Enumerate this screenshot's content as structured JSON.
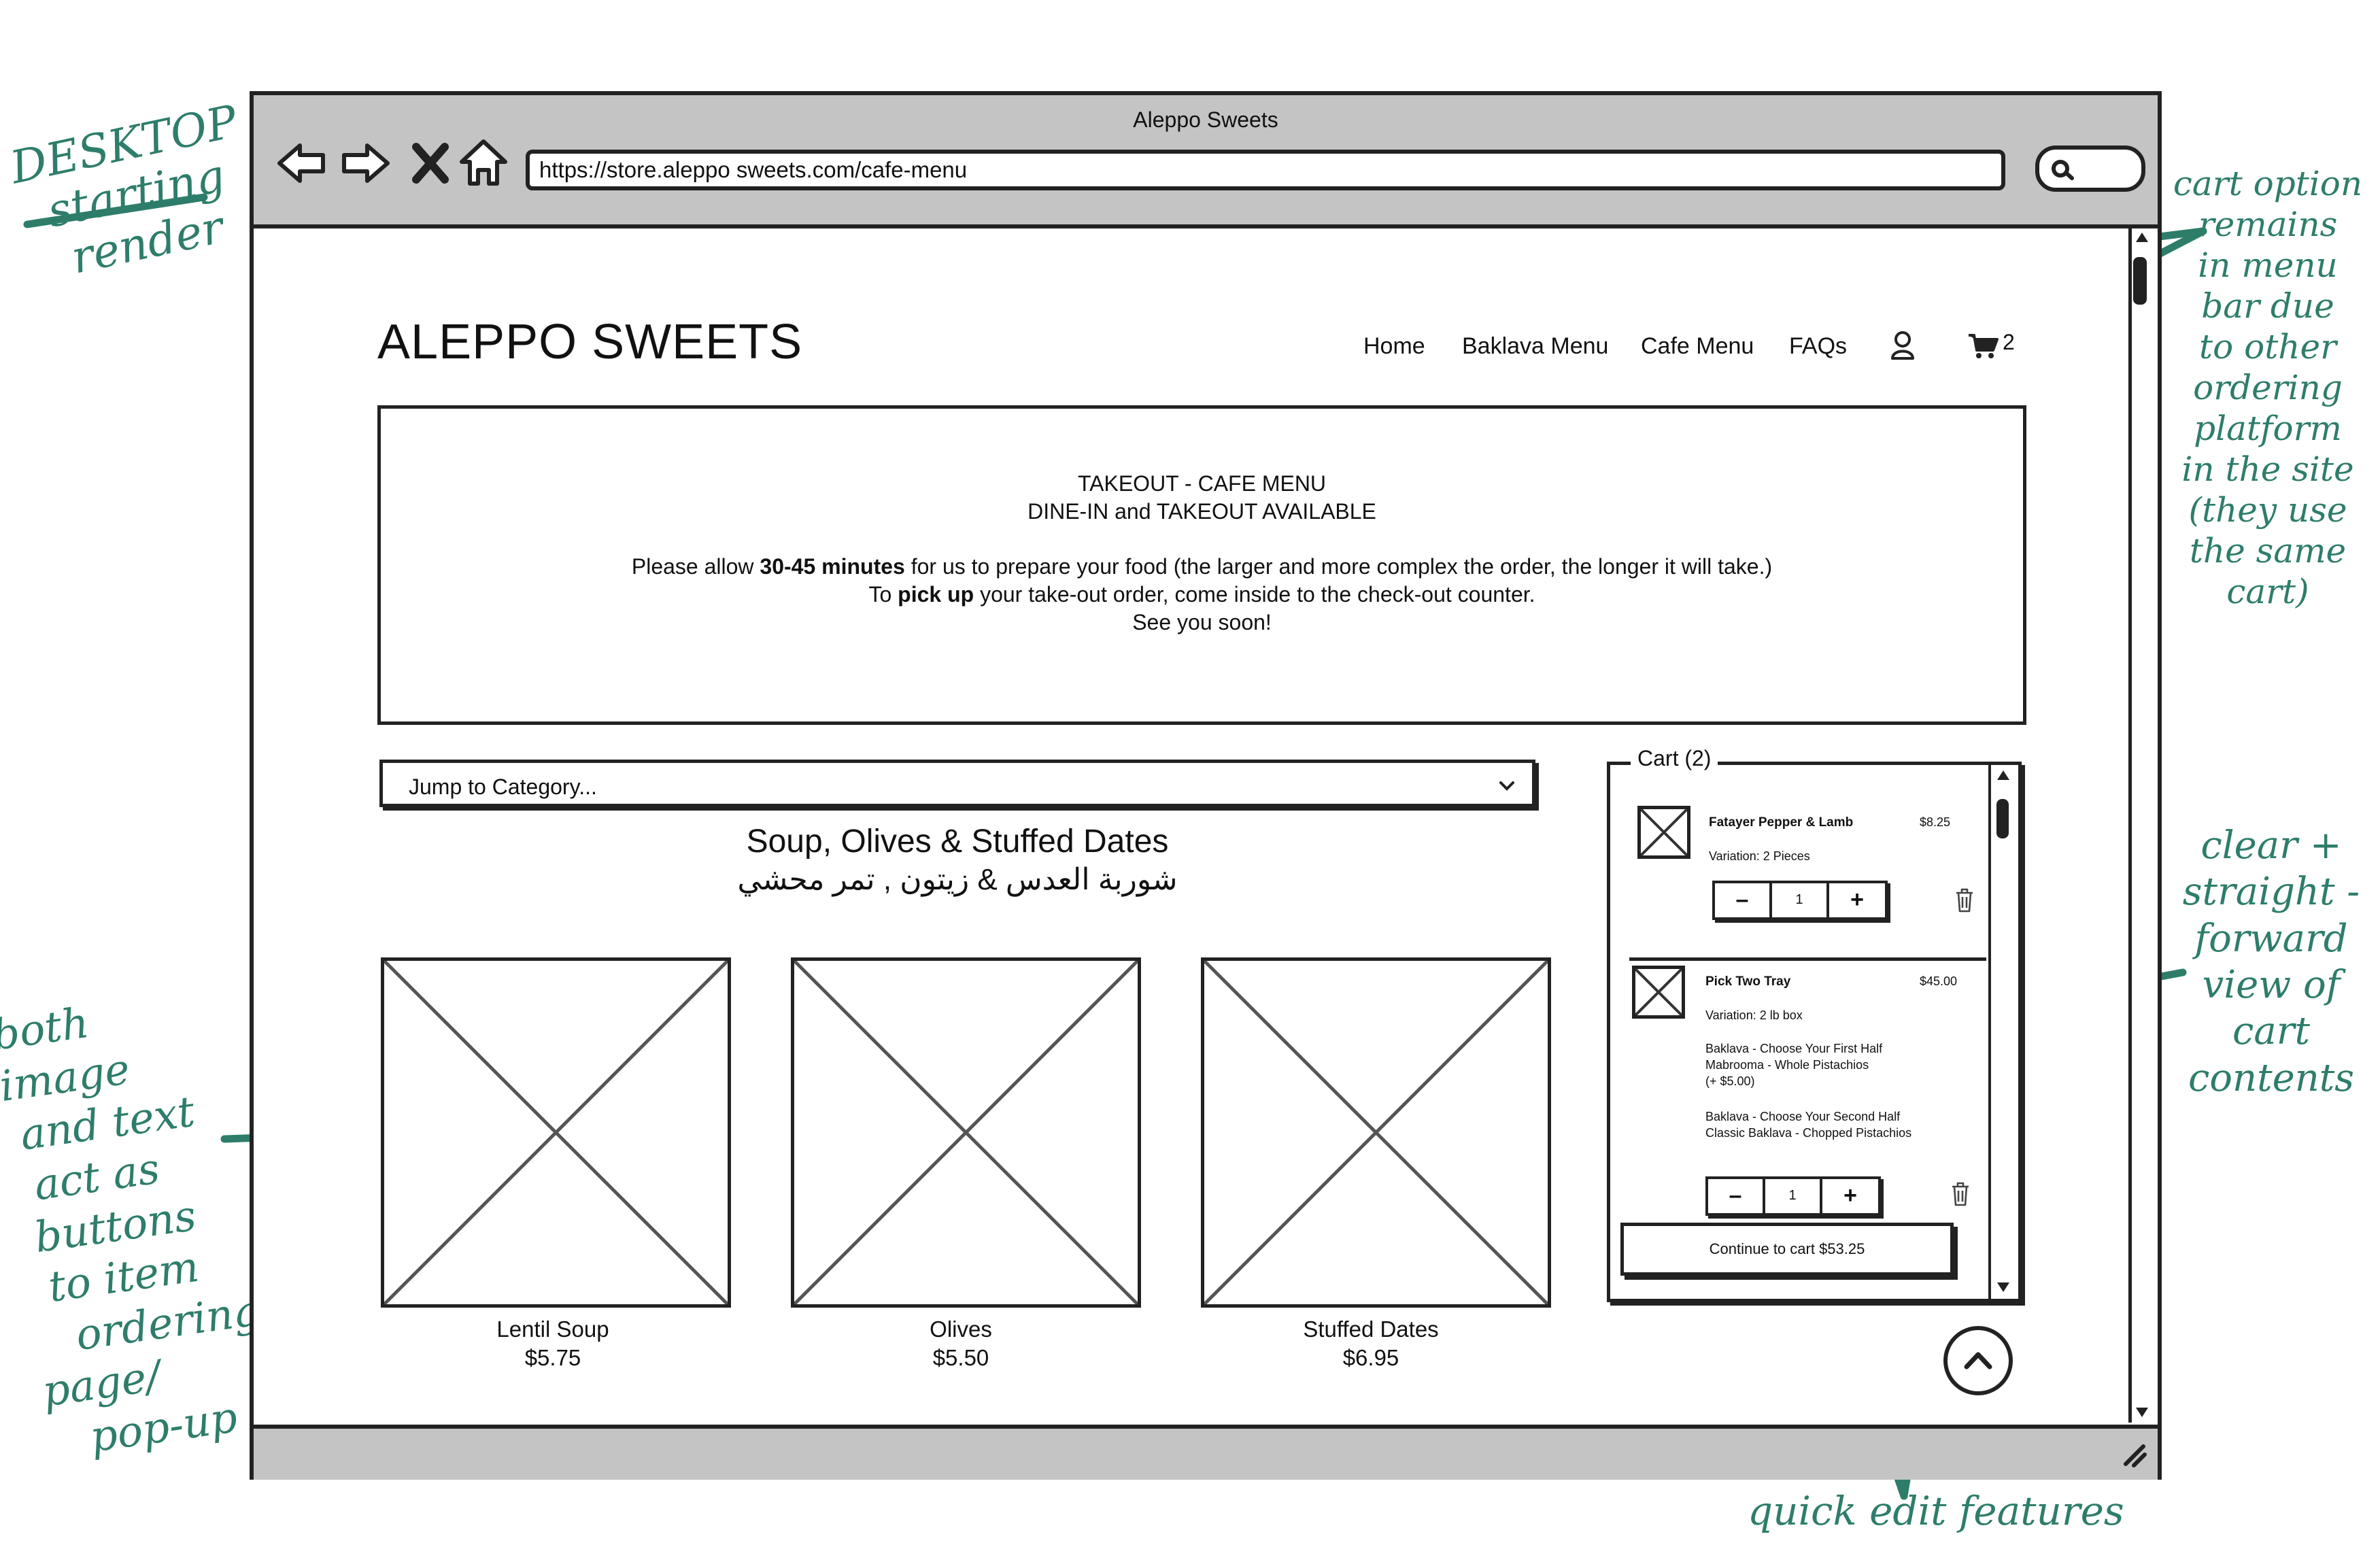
{
  "browser": {
    "title": "Aleppo Sweets",
    "url": "https://store.aleppo sweets.com/cafe-menu"
  },
  "site": {
    "logo": "ALEPPO SWEETS",
    "nav": [
      "Home",
      "Baklava Menu",
      "Cafe Menu",
      "FAQs"
    ],
    "cart_count": "2"
  },
  "banner": {
    "line1": "TAKEOUT - CAFE MENU",
    "line2": "DINE-IN and TAKEOUT AVAILABLE",
    "line3_a": "Please allow ",
    "line3_bold": "30-45 minutes",
    "line3_b": " for us to prepare your food (the larger and more complex the order, the longer it will take.)",
    "line4_a": "To ",
    "line4_bold": "pick up",
    "line4_b": " your take-out order, come inside to the check-out counter.",
    "line5": "See you soon!"
  },
  "category": {
    "jump_label": "Jump to Category...",
    "title": "Soup, Olives & Stuffed Dates",
    "title_ar": "شوربة العدس & زيتون , تمر محشي"
  },
  "products": [
    {
      "name": "Lentil Soup",
      "price": "$5.75"
    },
    {
      "name": "Olives",
      "price": "$5.50"
    },
    {
      "name": "Stuffed Dates",
      "price": "$6.95"
    }
  ],
  "cart": {
    "title": "Cart (2)",
    "items": [
      {
        "name": "Fatayer Pepper & Lamb",
        "price": "$8.25",
        "variation": "Variation: 2 Pieces",
        "qty": "1"
      },
      {
        "name": "Pick Two Tray",
        "price": "$45.00",
        "variation": "Variation: 2 lb box",
        "opt1_a": "Baklava - Choose Your First Half",
        "opt1_b": "Mabrooma - Whole Pistachios",
        "opt1_c": "(+ $5.00)",
        "opt2_a": "Baklava - Choose Your Second Half",
        "opt2_b": "Classic Baklava - Chopped Pistachios",
        "qty": "1"
      }
    ],
    "continue": "Continue to cart $53.25",
    "minus": "–",
    "plus": "+"
  },
  "annotations": {
    "desktop": [
      "DESKTOP -",
      "starting",
      "render"
    ],
    "cart_note": [
      "cart option",
      "remains",
      "in menu",
      "bar due",
      "to other",
      "ordering",
      "platform",
      "in the site",
      "(they use",
      "the same",
      "cart)"
    ],
    "clear_note": [
      "clear +",
      "straight -",
      "forward",
      "view of",
      "cart",
      "contents"
    ],
    "both_note": [
      "both image",
      "and text",
      "act as",
      "buttons",
      "to item",
      "ordering",
      "page/",
      "pop-up"
    ],
    "quick_note": "quick edit features"
  },
  "colors": {
    "annotation": "#2e7d6b",
    "chrome": "#c4c4c4",
    "ink": "#222222"
  }
}
